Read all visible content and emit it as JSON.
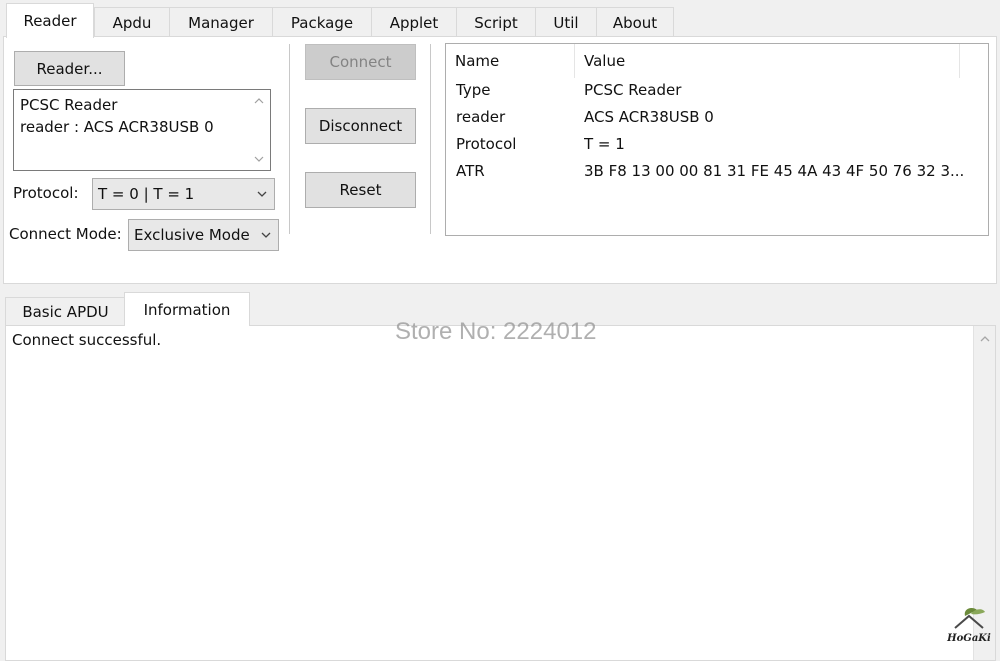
{
  "top_tabs": [
    {
      "label": "Reader",
      "active": true
    },
    {
      "label": "Apdu"
    },
    {
      "label": "Manager"
    },
    {
      "label": "Package"
    },
    {
      "label": "Applet"
    },
    {
      "label": "Script"
    },
    {
      "label": "Util"
    },
    {
      "label": "About"
    }
  ],
  "reader_panel": {
    "reader_button": "Reader...",
    "reader_lines": [
      "PCSC Reader",
      "reader : ACS ACR38USB 0"
    ],
    "protocol_label": "Protocol:",
    "protocol_value": "T = 0 | T = 1",
    "connect_mode_label": "Connect Mode:",
    "connect_mode_value": "Exclusive Mode"
  },
  "actions": {
    "connect": "Connect",
    "disconnect": "Disconnect",
    "reset": "Reset"
  },
  "properties": {
    "headers": [
      "Name",
      "Value"
    ],
    "rows": [
      {
        "name": "Type",
        "value": "PCSC Reader"
      },
      {
        "name": "reader",
        "value": "ACS ACR38USB 0"
      },
      {
        "name": "Protocol",
        "value": "T = 1"
      },
      {
        "name": "ATR",
        "value": "3B F8 13 00 00 81 31 FE 45 4A 43 4F 50 76 32 3..."
      }
    ]
  },
  "bottom_tabs": [
    {
      "label": "Basic APDU"
    },
    {
      "label": "Information",
      "active": true
    }
  ],
  "information": {
    "text": "Connect successful."
  },
  "overlay": {
    "watermark": "Store No: 2224012",
    "logo_text": "HoGaKi"
  }
}
